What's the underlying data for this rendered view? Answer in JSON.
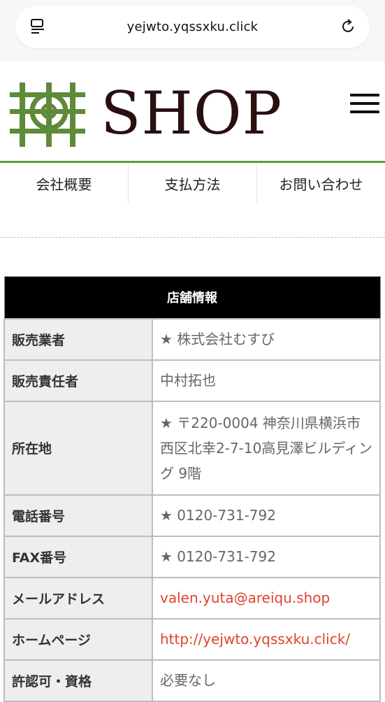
{
  "browser": {
    "url": "yejwto.yqssxku.click"
  },
  "header": {
    "logo_text": "SHOP",
    "menu_icon": "hamburger-menu-icon"
  },
  "nav": {
    "items": [
      "会社概要",
      "支払方法",
      "お問い合わせ"
    ]
  },
  "table": {
    "title": "店舗情報",
    "rows": [
      {
        "label": "販売業者",
        "value": "★ 株式会社むすび"
      },
      {
        "label": "販売責任者",
        "value": "中村拓也"
      },
      {
        "label": "所在地",
        "value": "★ 〒220-0004 神奈川県横浜市西区北幸2-7-10高見澤ビルディング 9階"
      },
      {
        "label": "電話番号",
        "value": "★ 0120-731-792"
      },
      {
        "label": "FAX番号",
        "value": "★ 0120-731-792"
      },
      {
        "label": "メールアドレス",
        "value": "valen.yuta@areiqu.shop"
      },
      {
        "label": "ホームページ",
        "value": "http://yejwto.yqssxku.click/"
      },
      {
        "label": "許認可・資格",
        "value": "必要なし"
      }
    ]
  },
  "colors": {
    "accent_green": "#5f9a3a",
    "link_red": "#e0442b",
    "logo_brown": "#2a0f10"
  }
}
